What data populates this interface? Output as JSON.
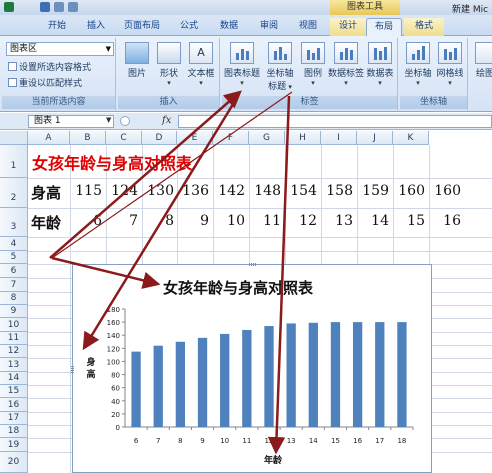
{
  "titlebar": {
    "context_tab_title": "图表工具",
    "window_title": "新建 Mic"
  },
  "tabs": [
    {
      "label": "开始"
    },
    {
      "label": "插入"
    },
    {
      "label": "页面布局"
    },
    {
      "label": "公式"
    },
    {
      "label": "数据"
    },
    {
      "label": "审阅"
    },
    {
      "label": "视图"
    },
    {
      "label": "设计"
    },
    {
      "label": "布局"
    },
    {
      "label": "格式"
    }
  ],
  "ribbon": {
    "selection_group": {
      "combo_value": "图表区",
      "format_selection": "设置所选内容格式",
      "reset_style": "重设以匹配样式",
      "label": "当前所选内容"
    },
    "insert_group": {
      "picture": "图片",
      "shapes": "形状",
      "textbox": "文本框",
      "label": "插入"
    },
    "labels_group": {
      "chart_title": "图表标题",
      "axis_titles_line1": "坐标轴",
      "axis_titles_line2": "标题",
      "legend": "图例",
      "data_labels": "数据标签",
      "data_table": "数据表",
      "label": "标签"
    },
    "axes_group": {
      "axes": "坐标轴",
      "gridlines": "网格线",
      "label": "坐标轴"
    },
    "plot_group": {
      "plot_area": "绘图"
    }
  },
  "formula_bar": {
    "name_box": "图表 1",
    "fx": "fx"
  },
  "columns": [
    "A",
    "B",
    "C",
    "D",
    "E",
    "F",
    "G",
    "H",
    "I",
    "J",
    "K"
  ],
  "rows": [
    "1",
    "2",
    "3",
    "4",
    "5",
    "6",
    "7",
    "8",
    "9",
    "10",
    "11",
    "12",
    "13",
    "14",
    "15",
    "16",
    "17",
    "18",
    "19",
    "20"
  ],
  "sheet": {
    "title": "女孩年龄与身高对照表",
    "height_label": "身高",
    "heights": [
      "115",
      "124",
      "130",
      "136",
      "142",
      "148",
      "154",
      "158",
      "159",
      "160",
      "160"
    ],
    "age_label": "年龄",
    "ages": [
      "6",
      "7",
      "8",
      "9",
      "10",
      "11",
      "12",
      "13",
      "14",
      "15",
      "16"
    ]
  },
  "chart_data": {
    "type": "bar",
    "title": "女孩年龄与身高对照表",
    "ylabel": "身高",
    "xlabel": "年龄",
    "categories": [
      "6",
      "7",
      "8",
      "9",
      "10",
      "11",
      "12",
      "13",
      "14",
      "15",
      "16",
      "17",
      "18"
    ],
    "values": [
      115,
      124,
      130,
      136,
      142,
      148,
      154,
      158,
      159,
      160,
      160,
      160,
      160
    ],
    "ylim": [
      0,
      180
    ],
    "yticks": [
      "0",
      "20",
      "40",
      "60",
      "80",
      "100",
      "120",
      "140",
      "160",
      "180"
    ],
    "bar_color": "#4f81bd",
    "legend": "none",
    "grid": false
  },
  "annotations": {
    "arrow_color": "#8b1a1a"
  }
}
